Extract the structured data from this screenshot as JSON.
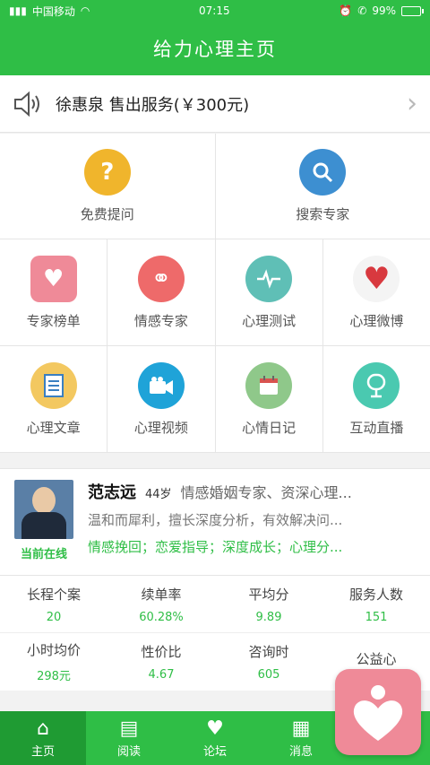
{
  "status": {
    "carrier": "中国移动",
    "time": "07:15",
    "battery": "99%"
  },
  "header": {
    "title": "给力心理主页"
  },
  "notice": {
    "text": "徐惠泉 售出服务(￥300元)"
  },
  "grid": {
    "row1": [
      {
        "label": "免费提问",
        "icon": "question-icon",
        "color": "#f0b52c"
      },
      {
        "label": "搜索专家",
        "icon": "search-icon",
        "color": "#3d8fd1"
      }
    ],
    "row2": [
      {
        "label": "专家榜单",
        "icon": "heart-person-icon",
        "color": "#ef8a98"
      },
      {
        "label": "情感专家",
        "icon": "couple-icon",
        "color": "#ee6a6a"
      },
      {
        "label": "心理测试",
        "icon": "heartbeat-icon",
        "color": "#5fbfb6"
      },
      {
        "label": "心理微博",
        "icon": "heart-icon",
        "color": "#d8393f"
      }
    ],
    "row3": [
      {
        "label": "心理文章",
        "icon": "article-icon",
        "color": "#f3c860"
      },
      {
        "label": "心理视频",
        "icon": "video-icon",
        "color": "#1fa3d8"
      },
      {
        "label": "心情日记",
        "icon": "calendar-icon",
        "color": "#8fc88a"
      },
      {
        "label": "互动直播",
        "icon": "microphone-icon",
        "color": "#4ac9b0"
      }
    ]
  },
  "expert": {
    "name": "范志远",
    "age": "44岁",
    "title": "情感婚姻专家、资深心理...",
    "desc": "温和而犀利，擅长深度分析，有效解决问...",
    "tags": "情感挽回；恋爱指导；深度成长；心理分...",
    "online": "当前在线",
    "stats_row1": [
      {
        "key": "长程个案",
        "value": "20"
      },
      {
        "key": "续单率",
        "value": "60.28%"
      },
      {
        "key": "平均分",
        "value": "9.89"
      },
      {
        "key": "服务人数",
        "value": "151"
      }
    ],
    "stats_row2": [
      {
        "key": "小时均价",
        "value": "298元"
      },
      {
        "key": "性价比",
        "value": "4.67"
      },
      {
        "key": "咨询时",
        "value": "605"
      },
      {
        "key": "公益心",
        "value": ""
      }
    ]
  },
  "nav": [
    {
      "label": "主页",
      "icon": "home-icon",
      "active": true
    },
    {
      "label": "阅读",
      "icon": "book-icon"
    },
    {
      "label": "论坛",
      "icon": "forum-icon"
    },
    {
      "label": "消息",
      "icon": "message-icon"
    },
    {
      "label": "",
      "icon": "profile-icon"
    }
  ]
}
